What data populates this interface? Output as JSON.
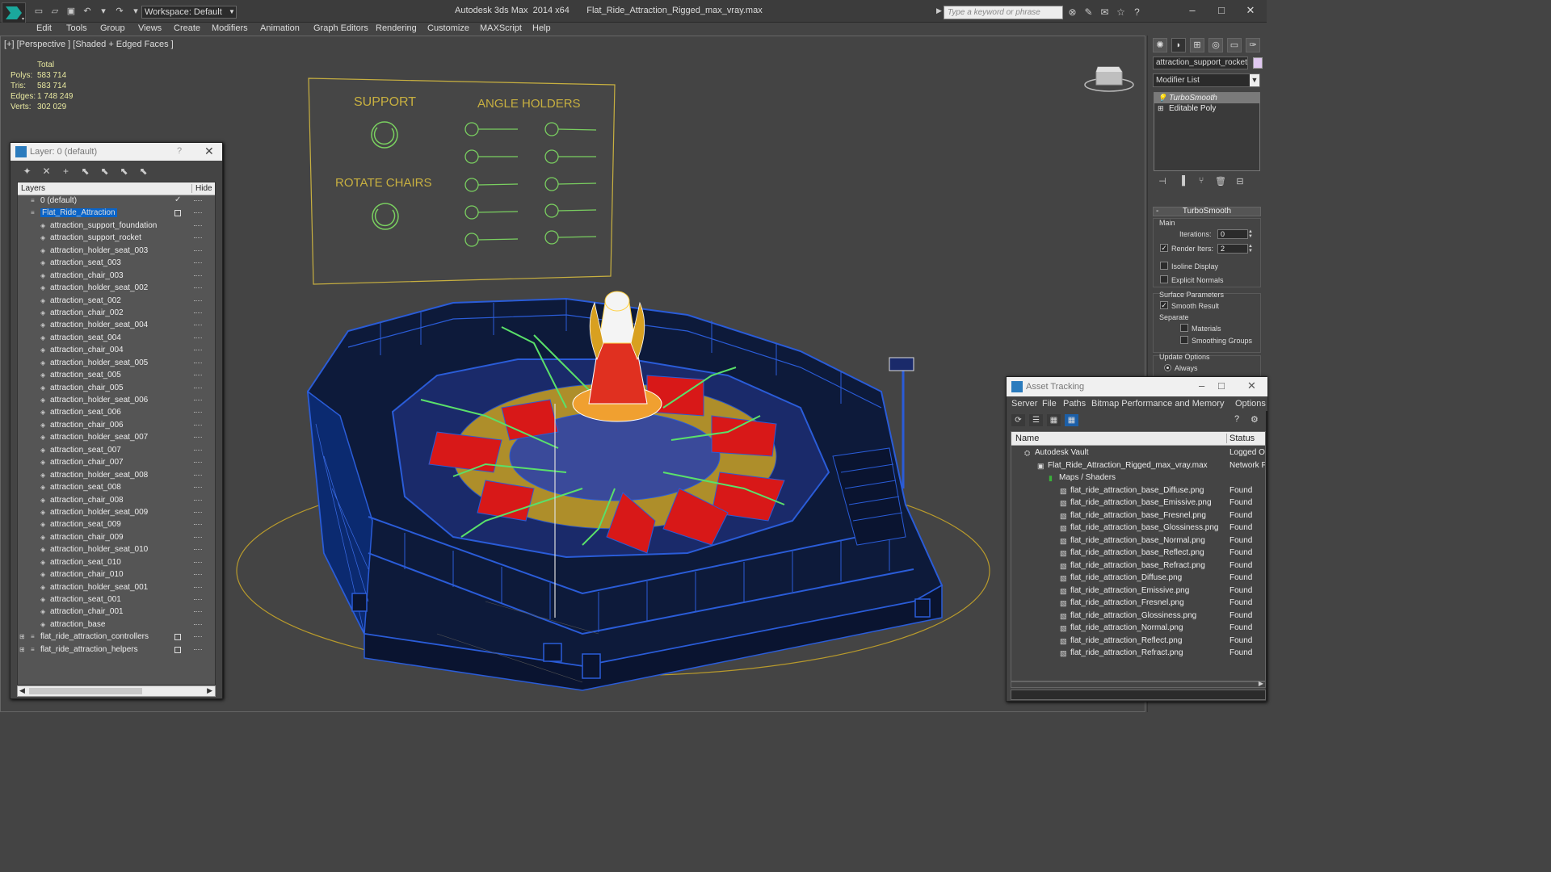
{
  "titlebar": {
    "workspace": "Workspace: Default",
    "window_title": "Autodesk 3ds Max  2014 x64       Flat_Ride_Attraction_Rigged_max_vray.max",
    "search_placeholder": "Type a keyword or phrase"
  },
  "menu": [
    "Edit",
    "Tools",
    "Group",
    "Views",
    "Create",
    "Modifiers",
    "Animation",
    "Graph Editors",
    "Rendering",
    "Customize",
    "MAXScript",
    "Help"
  ],
  "viewport": {
    "label": "[+] [Perspective ] [Shaded + Edged Faces ]",
    "stats": {
      "header": "Total",
      "rows": [
        {
          "k": "Polys:",
          "v": "583 714"
        },
        {
          "k": "Tris:",
          "v": "583 714"
        },
        {
          "k": "Edges:",
          "v": "1 748 249"
        },
        {
          "k": "Verts:",
          "v": "302 029"
        }
      ]
    },
    "controls_board": {
      "support": "SUPPORT",
      "angle_holders": "ANGLE HOLDERS",
      "rotate_chairs": "ROTATE CHAIRS"
    }
  },
  "right_panel": {
    "object_name": "attraction_support_rocket",
    "modifier_list": "Modifier List",
    "stack": [
      "TurboSmooth",
      "Editable Poly"
    ],
    "rollout": {
      "title": "TurboSmooth",
      "main": "Main",
      "iterations_label": "Iterations:",
      "iterations_value": "0",
      "render_iters_label": "Render Iters:",
      "render_iters_value": "2",
      "isoline": "Isoline Display",
      "explicit_normals": "Explicit Normals",
      "surface_params": "Surface Parameters",
      "smooth_result": "Smooth Result",
      "separate": "Separate",
      "materials": "Materials",
      "smoothing_groups": "Smoothing Groups",
      "update_options": "Update Options",
      "always": "Always"
    }
  },
  "layer_window": {
    "title": "Layer: 0 (default)",
    "help": "?",
    "col_layers": "Layers",
    "col_hide": "Hide",
    "rows": [
      {
        "name": "0 (default)",
        "level": 0,
        "type": "layer",
        "check": "✓"
      },
      {
        "name": "Flat_Ride_Attraction",
        "level": 0,
        "type": "layer",
        "selected": true,
        "box": true
      },
      {
        "name": "attraction_support_foundation",
        "level": 1,
        "type": "object"
      },
      {
        "name": "attraction_support_rocket",
        "level": 1,
        "type": "object"
      },
      {
        "name": "attraction_holder_seat_003",
        "level": 1,
        "type": "object"
      },
      {
        "name": "attraction_seat_003",
        "level": 1,
        "type": "object"
      },
      {
        "name": "attraction_chair_003",
        "level": 1,
        "type": "object"
      },
      {
        "name": "attraction_holder_seat_002",
        "level": 1,
        "type": "object"
      },
      {
        "name": "attraction_seat_002",
        "level": 1,
        "type": "object"
      },
      {
        "name": "attraction_chair_002",
        "level": 1,
        "type": "object"
      },
      {
        "name": "attraction_holder_seat_004",
        "level": 1,
        "type": "object"
      },
      {
        "name": "attraction_seat_004",
        "level": 1,
        "type": "object"
      },
      {
        "name": "attraction_chair_004",
        "level": 1,
        "type": "object"
      },
      {
        "name": "attraction_holder_seat_005",
        "level": 1,
        "type": "object"
      },
      {
        "name": "attraction_seat_005",
        "level": 1,
        "type": "object"
      },
      {
        "name": "attraction_chair_005",
        "level": 1,
        "type": "object"
      },
      {
        "name": "attraction_holder_seat_006",
        "level": 1,
        "type": "object"
      },
      {
        "name": "attraction_seat_006",
        "level": 1,
        "type": "object"
      },
      {
        "name": "attraction_chair_006",
        "level": 1,
        "type": "object"
      },
      {
        "name": "attraction_holder_seat_007",
        "level": 1,
        "type": "object"
      },
      {
        "name": "attraction_seat_007",
        "level": 1,
        "type": "object"
      },
      {
        "name": "attraction_chair_007",
        "level": 1,
        "type": "object"
      },
      {
        "name": "attraction_holder_seat_008",
        "level": 1,
        "type": "object"
      },
      {
        "name": "attraction_seat_008",
        "level": 1,
        "type": "object"
      },
      {
        "name": "attraction_chair_008",
        "level": 1,
        "type": "object"
      },
      {
        "name": "attraction_holder_seat_009",
        "level": 1,
        "type": "object"
      },
      {
        "name": "attraction_seat_009",
        "level": 1,
        "type": "object"
      },
      {
        "name": "attraction_chair_009",
        "level": 1,
        "type": "object"
      },
      {
        "name": "attraction_holder_seat_010",
        "level": 1,
        "type": "object"
      },
      {
        "name": "attraction_seat_010",
        "level": 1,
        "type": "object"
      },
      {
        "name": "attraction_chair_010",
        "level": 1,
        "type": "object"
      },
      {
        "name": "attraction_holder_seat_001",
        "level": 1,
        "type": "object"
      },
      {
        "name": "attraction_seat_001",
        "level": 1,
        "type": "object"
      },
      {
        "name": "attraction_chair_001",
        "level": 1,
        "type": "object"
      },
      {
        "name": "attraction_base",
        "level": 1,
        "type": "object"
      },
      {
        "name": "flat_ride_attraction_controllers",
        "level": 0,
        "type": "layer",
        "box": true
      },
      {
        "name": "flat_ride_attraction_helpers",
        "level": 0,
        "type": "layer",
        "box": true
      }
    ]
  },
  "asset_window": {
    "title": "Asset Tracking",
    "menu": [
      "Server",
      "File",
      "Paths",
      "Bitmap Performance and Memory",
      "Options"
    ],
    "col_name": "Name",
    "col_status": "Status",
    "rows": [
      {
        "name": "Autodesk Vault",
        "level": 0,
        "status": "Logged O"
      },
      {
        "name": "Flat_Ride_Attraction_Rigged_max_vray.max",
        "level": 1,
        "status": "Network F"
      },
      {
        "name": "Maps / Shaders",
        "level": 2,
        "status": ""
      },
      {
        "name": "flat_ride_attraction_base_Diffuse.png",
        "level": 3,
        "status": "Found"
      },
      {
        "name": "flat_ride_attraction_base_Emissive.png",
        "level": 3,
        "status": "Found"
      },
      {
        "name": "flat_ride_attraction_base_Fresnel.png",
        "level": 3,
        "status": "Found"
      },
      {
        "name": "flat_ride_attraction_base_Glossiness.png",
        "level": 3,
        "status": "Found"
      },
      {
        "name": "flat_ride_attraction_base_Normal.png",
        "level": 3,
        "status": "Found"
      },
      {
        "name": "flat_ride_attraction_base_Reflect.png",
        "level": 3,
        "status": "Found"
      },
      {
        "name": "flat_ride_attraction_base_Refract.png",
        "level": 3,
        "status": "Found"
      },
      {
        "name": "flat_ride_attraction_Diffuse.png",
        "level": 3,
        "status": "Found"
      },
      {
        "name": "flat_ride_attraction_Emissive.png",
        "level": 3,
        "status": "Found"
      },
      {
        "name": "flat_ride_attraction_Fresnel.png",
        "level": 3,
        "status": "Found"
      },
      {
        "name": "flat_ride_attraction_Glossiness.png",
        "level": 3,
        "status": "Found"
      },
      {
        "name": "flat_ride_attraction_Normal.png",
        "level": 3,
        "status": "Found"
      },
      {
        "name": "flat_ride_attraction_Reflect.png",
        "level": 3,
        "status": "Found"
      },
      {
        "name": "flat_ride_attraction_Refract.png",
        "level": 3,
        "status": "Found"
      }
    ]
  },
  "colors": {
    "wire_blue": "#2a5cd8",
    "board_yellow": "#c8b040",
    "control_green": "#7ad060",
    "seat_red": "#d81818",
    "selection_blue": "#0a64c8"
  }
}
